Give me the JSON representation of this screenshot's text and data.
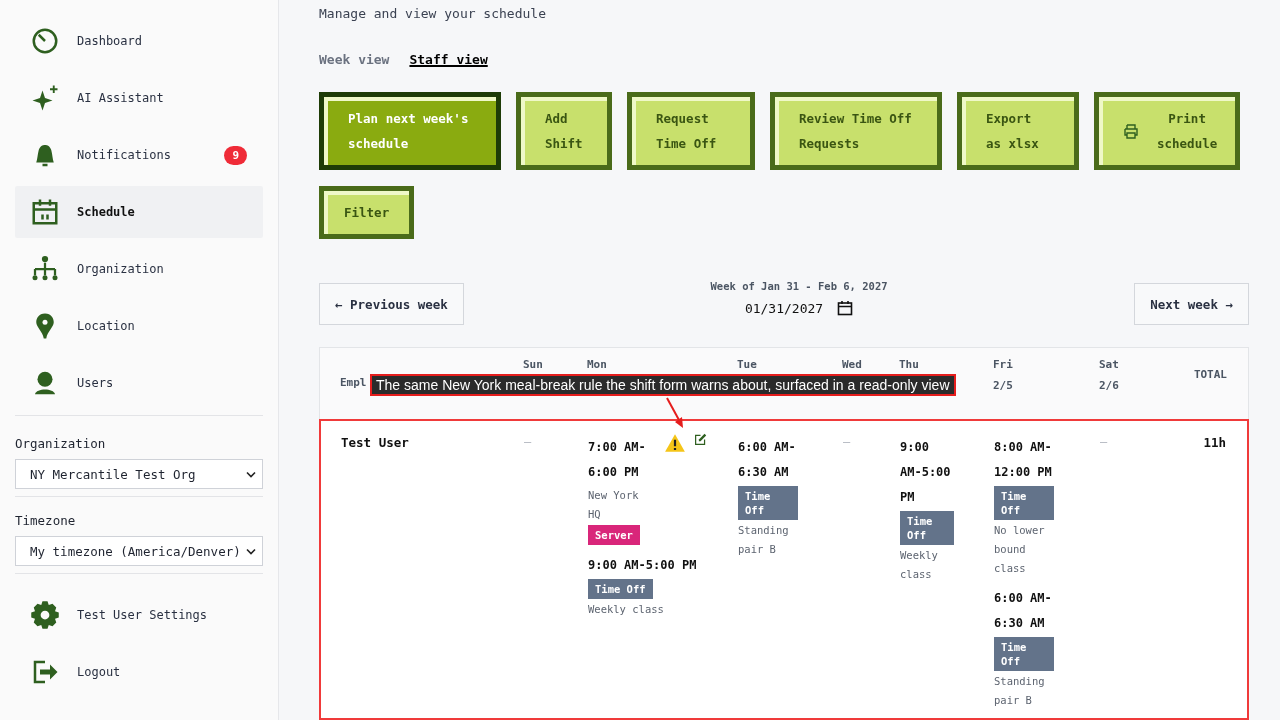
{
  "sidebar": {
    "items": [
      {
        "label": "Dashboard",
        "selected": false
      },
      {
        "label": "AI Assistant",
        "selected": false
      },
      {
        "label": "Notifications",
        "selected": false,
        "badge": "9"
      },
      {
        "label": "Schedule",
        "selected": true
      },
      {
        "label": "Organization",
        "selected": false
      },
      {
        "label": "Location",
        "selected": false
      },
      {
        "label": "Users",
        "selected": false
      }
    ],
    "selectors": [
      {
        "label": "Organization",
        "value": "NY Mercantile Test Org"
      },
      {
        "label": "Timezone",
        "value": "My timezone (America/Denver)"
      }
    ],
    "footer_items": [
      {
        "label": "Test User Settings"
      },
      {
        "label": "Logout"
      }
    ]
  },
  "subtitle": "Manage and view your schedule",
  "view_tabs": [
    {
      "label": "Week view",
      "selected": false
    },
    {
      "label": "Staff view",
      "selected": true
    }
  ],
  "actions": [
    {
      "label": "Plan next week's schedule",
      "kind": "primary"
    },
    {
      "label": "Add Shift",
      "kind": "plain"
    },
    {
      "label": "Request Time Off",
      "kind": "plain"
    },
    {
      "label": "Review Time Off Requests",
      "kind": "plain"
    },
    {
      "label": "Export as xlsx",
      "kind": "plain"
    },
    {
      "label": "Print schedule",
      "kind": "print"
    },
    {
      "label": "Filter",
      "kind": "plain"
    }
  ],
  "week_nav": {
    "previous": "← Previous week",
    "caption": "Week of Jan 31 - Feb 6, 2027",
    "date": "01/31/2027",
    "next": "Next week →"
  },
  "table": {
    "columns": [
      {
        "label": "Empl"
      },
      {
        "label": "Sun"
      },
      {
        "label": "Mon"
      },
      {
        "label": "Tue"
      },
      {
        "label": "Wed"
      },
      {
        "label": "Thu"
      },
      {
        "label": "Fri",
        "date": "2/5"
      },
      {
        "label": "Sat",
        "date": "2/6"
      },
      {
        "label": "TOTAL"
      }
    ],
    "rows": [
      {
        "employee": "Test User",
        "total": "11h",
        "days": [
          {
            "mark": "–"
          },
          {
            "entries": [
              {
                "time": "7:00 AM-6:00 PM",
                "location": "New York HQ",
                "tag": {
                  "label": "Server",
                  "kind": "role"
                },
                "warning": true,
                "editable": true
              },
              {
                "time": "9:00 AM-5:00 PM",
                "tag": {
                  "label": "Time Off",
                  "kind": "timeoff"
                },
                "note": "Weekly class"
              }
            ]
          },
          {
            "entries": [
              {
                "time": "6:00 AM-6:30 AM",
                "tag": {
                  "label": "Time Off",
                  "kind": "timeoff"
                },
                "note": "Standing pair B"
              }
            ]
          },
          {
            "mark": "–"
          },
          {
            "entries": [
              {
                "time": "9:00 AM-5:00 PM",
                "tag": {
                  "label": "Time Off",
                  "kind": "timeoff"
                },
                "note": "Weekly class"
              }
            ]
          },
          {
            "entries": [
              {
                "time": "8:00 AM-12:00 PM",
                "tag": {
                  "label": "Time Off",
                  "kind": "timeoff"
                },
                "note": "No lower bound class"
              },
              {
                "time": "6:00 AM-6:30 AM",
                "tag": {
                  "label": "Time Off",
                  "kind": "timeoff"
                },
                "note": "Standing pair B"
              }
            ]
          },
          {
            "mark": "–"
          }
        ]
      }
    ]
  },
  "annotation": {
    "text": "The same New York meal-break rule the shift form warns about, surfaced in a read-only view"
  }
}
